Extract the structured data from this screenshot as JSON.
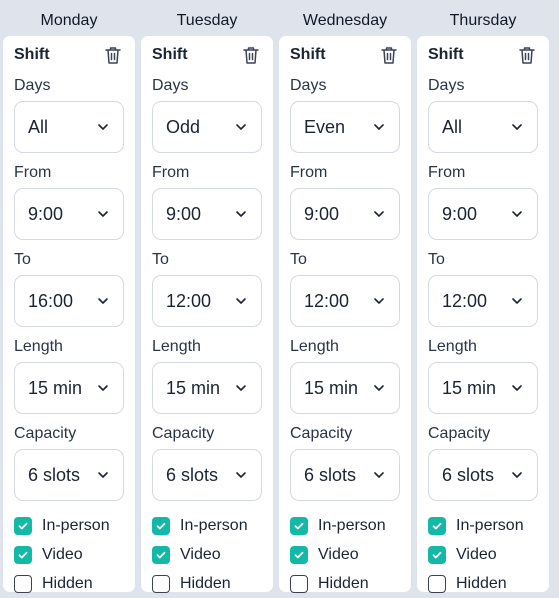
{
  "labels": {
    "shift": "Shift",
    "days": "Days",
    "from": "From",
    "to": "To",
    "length": "Length",
    "capacity": "Capacity",
    "in_person": "In-person",
    "video": "Video",
    "hidden": "Hidden"
  },
  "colors": {
    "checkbox_checked": "#14b8a6",
    "page_background": "#dfe4ec"
  },
  "columns": [
    {
      "day": "Monday",
      "days": "All",
      "from": "9:00",
      "to": "16:00",
      "length": "15 min",
      "capacity": "6 slots",
      "in_person": true,
      "video": true,
      "hidden": false
    },
    {
      "day": "Tuesday",
      "days": "Odd",
      "from": "9:00",
      "to": "12:00",
      "length": "15 min",
      "capacity": "6 slots",
      "in_person": true,
      "video": true,
      "hidden": false
    },
    {
      "day": "Wednesday",
      "days": "Even",
      "from": "9:00",
      "to": "12:00",
      "length": "15 min",
      "capacity": "6 slots",
      "in_person": true,
      "video": true,
      "hidden": false
    },
    {
      "day": "Thursday",
      "days": "All",
      "from": "9:00",
      "to": "12:00",
      "length": "15 min",
      "capacity": "6 slots",
      "in_person": true,
      "video": true,
      "hidden": false
    }
  ]
}
